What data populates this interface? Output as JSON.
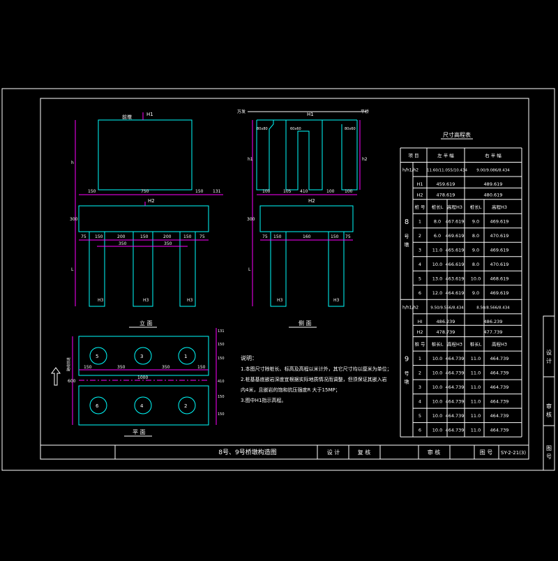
{
  "drawing": {
    "title": "8号、9号桥墩构造图",
    "drawing_no": "SY-2-21(3)",
    "title_block": {
      "design": "设 计",
      "review": "复 核",
      "check": "审 核",
      "number_label": "图 号"
    },
    "side_strip": [
      "设",
      "计",
      "日",
      "期",
      "审",
      "核",
      "图",
      "号"
    ]
  },
  "views": {
    "elevation": {
      "label": "立 面",
      "top_note": "前墩",
      "dims_top": [
        "150",
        "750",
        "150",
        "131"
      ],
      "dims_bottom": [
        "75",
        "150",
        "200",
        "150",
        "200",
        "150",
        "75"
      ],
      "dims_bottom2": [
        "350",
        "350"
      ],
      "left_dims": [
        "h",
        "300",
        "L"
      ],
      "labels": {
        "H1": "H1",
        "H2": "H2",
        "H3": "H3"
      }
    },
    "side": {
      "label": "侧 面",
      "top_left": "万发",
      "top_right": "平桥",
      "cap_dims": [
        "80x80",
        "60x60",
        "80x60"
      ],
      "dims_top": [
        "100",
        "105",
        "410",
        "100",
        "100"
      ],
      "dims_bottom": [
        "75",
        "150",
        "160",
        "150",
        "75"
      ],
      "left_dims": [
        "h1",
        "h2",
        "300",
        "L"
      ],
      "labels": {
        "H1": "H1",
        "H2": "H2",
        "H3": "H3"
      }
    },
    "plan": {
      "label": "平 面",
      "arrow_label": "路线前进",
      "dims_top": [
        "150",
        "350",
        "350",
        "150"
      ],
      "total": "1000",
      "left_dim": "600",
      "right_dims": [
        "131",
        "150",
        "150",
        "410",
        "150",
        "150"
      ],
      "piles_top": [
        "5",
        "3",
        "1"
      ],
      "piles_bottom": [
        "6",
        "4",
        "2"
      ]
    }
  },
  "notes": {
    "title": "说明：",
    "items": [
      "1.本图尺寸除桩长、标高及高程以米计外，其它尺寸均以厘米为单位；",
      "2.桩基基底嵌岩深度宜根据实际地质情况而调整，但须保证其嵌入岩",
      "  内4米，且嵌岩的饱和抗压强度R  大于15MP；",
      "3.图中H1指示高程。"
    ]
  },
  "table": {
    "title": "尺寸高程表",
    "header": [
      "项 目",
      "左 半 幅",
      "右 半 幅"
    ],
    "groups": [
      {
        "pier_no": "8",
        "pier_word": "号墩",
        "hh": {
          "label": "h/h1/h2",
          "left": "11.60/11.055/10.434",
          "right": "9.00/9.086/8.434"
        },
        "H1": {
          "label": "H1",
          "left": "459.619",
          "right": "489.619"
        },
        "H2": {
          "label": "H2",
          "left": "478.619",
          "right": "480.619"
        },
        "col_header": [
          "桩 号",
          "桩长L",
          "高程H3",
          "桩长L",
          "高程H3"
        ],
        "rows": [
          [
            "1",
            "8.0",
            "467.619",
            "9.0",
            "469.619"
          ],
          [
            "2",
            "6.0",
            "469.619",
            "8.0",
            "470.619"
          ],
          [
            "3",
            "11.0",
            "465.619",
            "9.0",
            "469.619"
          ],
          [
            "4",
            "10.0",
            "466.619",
            "8.0",
            "470.619"
          ],
          [
            "5",
            "13.0",
            "463.619",
            "10.0",
            "468.619"
          ],
          [
            "6",
            "12.0",
            "464.619",
            "9.0",
            "469.619"
          ]
        ]
      },
      {
        "pier_no": "9",
        "pier_word": "号墩",
        "hh": {
          "label": "h/h1/h2",
          "left": "9.50/9.566/8.434",
          "right": "8.50/8.566/8.434"
        },
        "H1": {
          "label": "HI",
          "left": "486.239",
          "right": "486.239"
        },
        "H2": {
          "label": "H2",
          "left": "478.739",
          "right": "477.739"
        },
        "col_header": [
          "桩 号",
          "桩长L",
          "高程H3",
          "桩长L",
          "高程H3"
        ],
        "rows": [
          [
            "1",
            "10.0",
            "464.739",
            "11.0",
            "464.739"
          ],
          [
            "2",
            "10.0",
            "464.739",
            "11.0",
            "464.739"
          ],
          [
            "3",
            "10.0",
            "464.739",
            "11.0",
            "464.739"
          ],
          [
            "4",
            "10.0",
            "464.739",
            "11.0",
            "464.739"
          ],
          [
            "5",
            "10.0",
            "464.739",
            "11.0",
            "464.739"
          ],
          [
            "6",
            "10.0",
            "464.739",
            "11.0",
            "464.739"
          ]
        ]
      }
    ]
  },
  "colors": {
    "background": "#000000",
    "border": "#ffffff",
    "geometry": "#00ffff",
    "dimension": "#ff00ff",
    "text": "#ffffff",
    "table_text": "#ffffff"
  }
}
